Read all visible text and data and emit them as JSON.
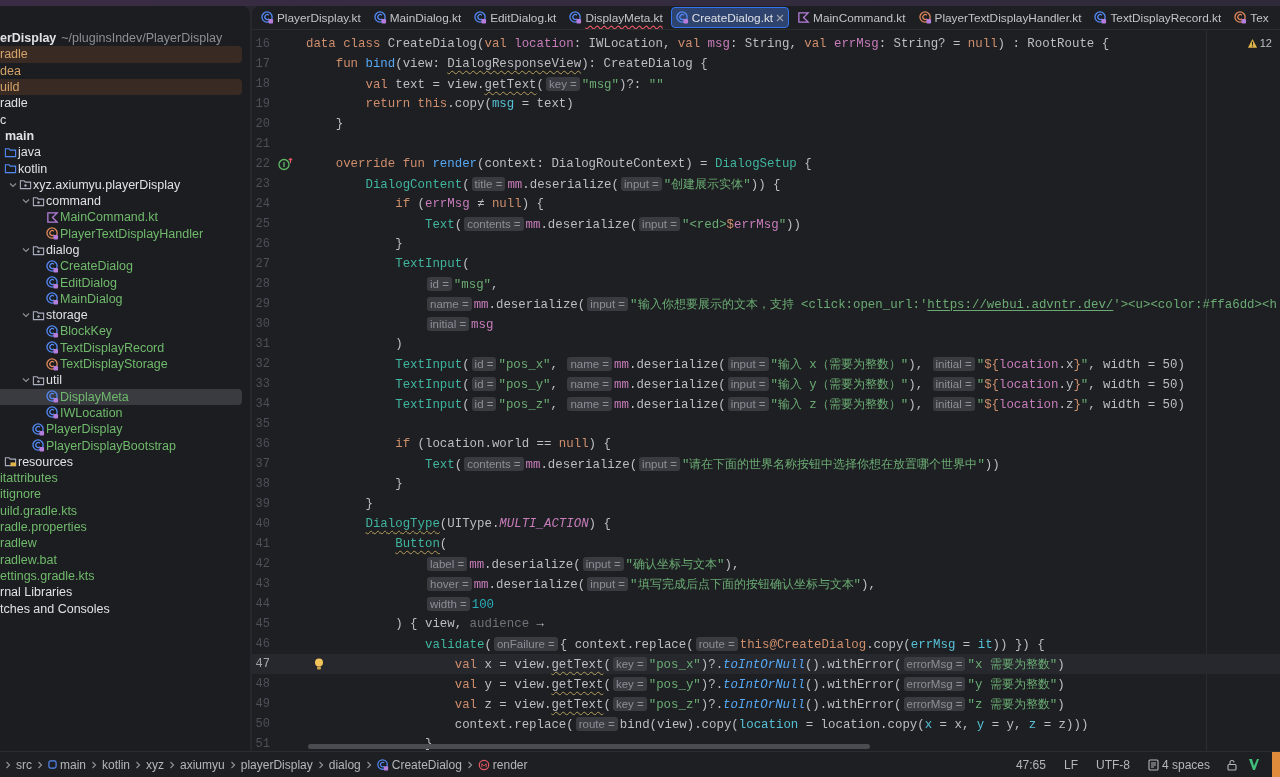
{
  "project": {
    "name": "erDisplay",
    "path": "~/pluginsIndev/PlayerDisplay",
    "items": [
      {
        "label": "radle",
        "ignored": true,
        "added": false,
        "excluded": true,
        "selected": false
      },
      {
        "label": "dea",
        "ignored": true,
        "added": false,
        "excluded": false,
        "selected": false
      },
      {
        "label": "uild",
        "ignored": true,
        "added": false,
        "excluded": true,
        "selected": false
      },
      {
        "label": "radle",
        "ignored": false,
        "added": false,
        "excluded": false,
        "selected": false
      },
      {
        "label": "c",
        "ignored": false,
        "added": false,
        "excluded": false,
        "selected": false,
        "children": [
          {
            "label": "main",
            "kind": "module",
            "selected": false,
            "children": [
              {
                "label": "java",
                "kind": "source-root",
                "selected": false
              },
              {
                "label": "kotlin",
                "kind": "source-root",
                "selected": false,
                "children": [
                  {
                    "label": "xyz.axiumyu.playerDisplay",
                    "kind": "package",
                    "expanded": true,
                    "selected": false,
                    "children": [
                      {
                        "label": "command",
                        "kind": "package",
                        "expanded": true,
                        "added": false,
                        "selected": false,
                        "children": [
                          {
                            "label": "MainCommand.kt",
                            "kind": "kotlin-file",
                            "added": true,
                            "selected": false
                          },
                          {
                            "label": "PlayerTextDisplayHandler",
                            "kind": "object",
                            "added": true,
                            "selected": false
                          }
                        ]
                      },
                      {
                        "label": "dialog",
                        "kind": "package",
                        "expanded": true,
                        "added": false,
                        "selected": false,
                        "children": [
                          {
                            "label": "CreateDialog",
                            "kind": "class",
                            "added": true,
                            "selected": false
                          },
                          {
                            "label": "EditDialog",
                            "kind": "class",
                            "added": true,
                            "selected": false
                          },
                          {
                            "label": "MainDialog",
                            "kind": "class",
                            "added": true,
                            "selected": false
                          }
                        ]
                      },
                      {
                        "label": "storage",
                        "kind": "package",
                        "expanded": true,
                        "added": false,
                        "selected": false,
                        "children": [
                          {
                            "label": "BlockKey",
                            "kind": "class",
                            "added": true,
                            "selected": false
                          },
                          {
                            "label": "TextDisplayRecord",
                            "kind": "class",
                            "added": true,
                            "selected": false
                          },
                          {
                            "label": "TextDisplayStorage",
                            "kind": "object",
                            "added": true,
                            "selected": false
                          }
                        ]
                      },
                      {
                        "label": "util",
                        "kind": "package",
                        "expanded": true,
                        "added": false,
                        "selected": false,
                        "children": [
                          {
                            "label": "DisplayMeta",
                            "kind": "class",
                            "added": true,
                            "selected": true
                          },
                          {
                            "label": "IWLocation",
                            "kind": "class",
                            "added": true,
                            "selected": false
                          }
                        ]
                      },
                      {
                        "label": "PlayerDisplay",
                        "kind": "class",
                        "added": true,
                        "selected": false
                      },
                      {
                        "label": "PlayerDisplayBootstrap",
                        "kind": "class",
                        "added": true,
                        "selected": false
                      }
                    ]
                  }
                ]
              },
              {
                "label": "resources",
                "kind": "resource-root",
                "selected": false
              }
            ]
          }
        ]
      },
      {
        "label": "itattributes",
        "ignored": false,
        "added": true,
        "excluded": false,
        "selected": false
      },
      {
        "label": "itignore",
        "ignored": false,
        "added": true,
        "excluded": false,
        "selected": false
      },
      {
        "label": "uild.gradle.kts",
        "ignored": false,
        "added": true,
        "excluded": false,
        "selected": false
      },
      {
        "label": "radle.properties",
        "ignored": false,
        "added": true,
        "excluded": false,
        "selected": false
      },
      {
        "label": "radlew",
        "ignored": false,
        "added": true,
        "excluded": false,
        "selected": false
      },
      {
        "label": "radlew.bat",
        "ignored": false,
        "added": true,
        "excluded": false,
        "selected": false
      },
      {
        "label": "ettings.gradle.kts",
        "ignored": false,
        "added": true,
        "excluded": false,
        "selected": false
      },
      {
        "label": "rnal Libraries",
        "ignored": false,
        "added": false,
        "excluded": false,
        "selected": false
      },
      {
        "label": "tches and Consoles",
        "ignored": false,
        "added": false,
        "excluded": false,
        "selected": false
      }
    ]
  },
  "tabs": [
    {
      "label": "PlayerDisplay.kt",
      "kind": "class",
      "selected": false,
      "error": false
    },
    {
      "label": "MainDialog.kt",
      "kind": "class",
      "selected": false,
      "error": false
    },
    {
      "label": "EditDialog.kt",
      "kind": "class",
      "selected": false,
      "error": false
    },
    {
      "label": "DisplayMeta.kt",
      "kind": "class",
      "selected": false,
      "error": true
    },
    {
      "label": "CreateDialog.kt",
      "kind": "class",
      "selected": true,
      "error": false
    },
    {
      "label": "MainCommand.kt",
      "kind": "kotlin-file",
      "selected": false,
      "error": false
    },
    {
      "label": "PlayerTextDisplayHandler.kt",
      "kind": "object",
      "selected": false,
      "error": false
    },
    {
      "label": "TextDisplayRecord.kt",
      "kind": "class",
      "selected": false,
      "error": false
    },
    {
      "label": "Tex",
      "kind": "object",
      "selected": false,
      "error": false
    }
  ],
  "editor": {
    "warnings": "12",
    "lines": [
      {
        "number": "16",
        "current": false,
        "tokens": [
          {
            "kind": "kw",
            "text": "data class "
          },
          {
            "kind": "plain",
            "text": "CreateDialog("
          },
          {
            "kind": "kw",
            "text": "val "
          },
          {
            "kind": "prop",
            "text": "location"
          },
          {
            "kind": "plain",
            "text": ": IWLocation, "
          },
          {
            "kind": "kw",
            "text": "val "
          },
          {
            "kind": "prop",
            "text": "msg"
          },
          {
            "kind": "plain",
            "text": ": String, "
          },
          {
            "kind": "kw",
            "text": "val "
          },
          {
            "kind": "prop",
            "text": "errMsg"
          },
          {
            "kind": "plain",
            "text": ": String? = "
          },
          {
            "kind": "kw",
            "text": "null"
          },
          {
            "kind": "plain",
            "text": ") : RootRoute {"
          }
        ]
      },
      {
        "number": "17",
        "current": false,
        "tokens": [
          {
            "kind": "kw",
            "text": "    fun "
          },
          {
            "kind": "fn",
            "text": "bind"
          },
          {
            "kind": "plain",
            "text": "(view: "
          },
          {
            "kind": "warn",
            "text": "DialogResponseView"
          },
          {
            "kind": "plain",
            "text": "): CreateDialog {"
          }
        ]
      },
      {
        "number": "18",
        "current": false,
        "tokens": [
          {
            "kind": "kw",
            "text": "        val "
          },
          {
            "kind": "plain",
            "text": "text = view."
          },
          {
            "kind": "warn",
            "text": "getText"
          },
          {
            "kind": "plain",
            "text": "("
          },
          {
            "kind": "hint",
            "text": "key ="
          },
          {
            "kind": "str",
            "text": "\"msg\""
          },
          {
            "kind": "plain",
            "text": ")?: "
          },
          {
            "kind": "str",
            "text": "\"\""
          }
        ]
      },
      {
        "number": "19",
        "current": false,
        "tokens": [
          {
            "kind": "kw",
            "text": "        return this"
          },
          {
            "kind": "plain",
            "text": ".copy("
          },
          {
            "kind": "arg",
            "text": "msg"
          },
          {
            "kind": "plain",
            "text": " = text)"
          }
        ]
      },
      {
        "number": "20",
        "current": false,
        "tokens": [
          {
            "kind": "plain",
            "text": "    }"
          }
        ]
      },
      {
        "number": "21",
        "current": false
      },
      {
        "number": "22",
        "current": false,
        "overrides": true,
        "tokens": [
          {
            "kind": "kw",
            "text": "    override fun "
          },
          {
            "kind": "fn",
            "text": "render"
          },
          {
            "kind": "plain",
            "text": "(context: DialogRouteContext) = "
          },
          {
            "kind": "call",
            "text": "DialogSetup"
          },
          {
            "kind": "plain",
            "text": " {"
          }
        ]
      },
      {
        "number": "23",
        "current": false,
        "tokens": [
          {
            "kind": "call",
            "text": "        DialogContent"
          },
          {
            "kind": "plain",
            "text": "("
          },
          {
            "kind": "hint",
            "text": "title ="
          },
          {
            "kind": "prop",
            "text": "mm"
          },
          {
            "kind": "plain",
            "text": ".deserialize("
          },
          {
            "kind": "hint",
            "text": "input ="
          },
          {
            "kind": "str",
            "text": "\"创建展示实体\""
          },
          {
            "kind": "plain",
            "text": ")) {"
          }
        ]
      },
      {
        "number": "24",
        "current": false,
        "tokens": [
          {
            "kind": "kw",
            "text": "            if "
          },
          {
            "kind": "plain",
            "text": "("
          },
          {
            "kind": "prop",
            "text": "errMsg"
          },
          {
            "kind": "plain",
            "text": " ≠ "
          },
          {
            "kind": "kw",
            "text": "null"
          },
          {
            "kind": "plain",
            "text": ") {"
          }
        ]
      },
      {
        "number": "25",
        "current": false,
        "tokens": [
          {
            "kind": "call",
            "text": "                Text"
          },
          {
            "kind": "plain",
            "text": "("
          },
          {
            "kind": "hint",
            "text": "contents ="
          },
          {
            "kind": "prop",
            "text": "mm"
          },
          {
            "kind": "plain",
            "text": ".deserialize("
          },
          {
            "kind": "hint",
            "text": "input ="
          },
          {
            "kind": "str",
            "text": "\"<red>"
          },
          {
            "kind": "kw",
            "text": "$"
          },
          {
            "kind": "prop",
            "text": "errMsg"
          },
          {
            "kind": "str",
            "text": "\""
          },
          {
            "kind": "plain",
            "text": "))"
          }
        ]
      },
      {
        "number": "26",
        "current": false,
        "tokens": [
          {
            "kind": "plain",
            "text": "            }"
          }
        ]
      },
      {
        "number": "27",
        "current": false,
        "tokens": [
          {
            "kind": "call",
            "text": "            TextInput"
          },
          {
            "kind": "plain",
            "text": "("
          }
        ]
      },
      {
        "number": "28",
        "current": false,
        "tokens": [
          {
            "kind": "hint",
            "text": "                id ="
          },
          {
            "kind": "str",
            "text": "\"msg\""
          },
          {
            "kind": "plain",
            "text": ","
          }
        ]
      },
      {
        "number": "29",
        "current": false,
        "tokens": [
          {
            "kind": "hint",
            "text": "                name ="
          },
          {
            "kind": "prop",
            "text": "mm"
          },
          {
            "kind": "plain",
            "text": ".deserialize("
          },
          {
            "kind": "hint",
            "text": "input ="
          },
          {
            "kind": "str",
            "text": "\"输入你想要展示的文本，支持 <click:open_url:'"
          },
          {
            "kind": "link",
            "text": "https://webui.advntr.dev/"
          },
          {
            "kind": "str",
            "text": "'><u><color:#ffa6dd><h"
          }
        ]
      },
      {
        "number": "30",
        "current": false,
        "tokens": [
          {
            "kind": "hint",
            "text": "                initial ="
          },
          {
            "kind": "prop",
            "text": "msg"
          }
        ]
      },
      {
        "number": "31",
        "current": false,
        "tokens": [
          {
            "kind": "plain",
            "text": "            )"
          }
        ]
      },
      {
        "number": "32",
        "current": false,
        "tokens": [
          {
            "kind": "call",
            "text": "            TextInput"
          },
          {
            "kind": "plain",
            "text": "("
          },
          {
            "kind": "hint",
            "text": "id ="
          },
          {
            "kind": "str",
            "text": "\"pos_x\""
          },
          {
            "kind": "plain",
            "text": ", "
          },
          {
            "kind": "hint",
            "text": "name ="
          },
          {
            "kind": "prop",
            "text": "mm"
          },
          {
            "kind": "plain",
            "text": ".deserialize("
          },
          {
            "kind": "hint",
            "text": "input ="
          },
          {
            "kind": "str",
            "text": "\"输入 x（需要为整数）\""
          },
          {
            "kind": "plain",
            "text": "), "
          },
          {
            "kind": "hint",
            "text": "initial ="
          },
          {
            "kind": "str",
            "text": "\""
          },
          {
            "kind": "kw",
            "text": "${"
          },
          {
            "kind": "prop",
            "text": "location"
          },
          {
            "kind": "plain",
            "text": ".x"
          },
          {
            "kind": "kw",
            "text": "}"
          },
          {
            "kind": "str",
            "text": "\""
          },
          {
            "kind": "plain",
            "text": ", width = 50)"
          }
        ]
      },
      {
        "number": "33",
        "current": false,
        "tokens": [
          {
            "kind": "call",
            "text": "            TextInput"
          },
          {
            "kind": "plain",
            "text": "("
          },
          {
            "kind": "hint",
            "text": "id ="
          },
          {
            "kind": "str",
            "text": "\"pos_y\""
          },
          {
            "kind": "plain",
            "text": ", "
          },
          {
            "kind": "hint",
            "text": "name ="
          },
          {
            "kind": "prop",
            "text": "mm"
          },
          {
            "kind": "plain",
            "text": ".deserialize("
          },
          {
            "kind": "hint",
            "text": "input ="
          },
          {
            "kind": "str",
            "text": "\"输入 y（需要为整数）\""
          },
          {
            "kind": "plain",
            "text": "), "
          },
          {
            "kind": "hint",
            "text": "initial ="
          },
          {
            "kind": "str",
            "text": "\""
          },
          {
            "kind": "kw",
            "text": "${"
          },
          {
            "kind": "prop",
            "text": "location"
          },
          {
            "kind": "plain",
            "text": ".y"
          },
          {
            "kind": "kw",
            "text": "}"
          },
          {
            "kind": "str",
            "text": "\""
          },
          {
            "kind": "plain",
            "text": ", width = 50)"
          }
        ]
      },
      {
        "number": "34",
        "current": false,
        "tokens": [
          {
            "kind": "call",
            "text": "            TextInput"
          },
          {
            "kind": "plain",
            "text": "("
          },
          {
            "kind": "hint",
            "text": "id ="
          },
          {
            "kind": "str",
            "text": "\"pos_z\""
          },
          {
            "kind": "plain",
            "text": ", "
          },
          {
            "kind": "hint",
            "text": "name ="
          },
          {
            "kind": "prop",
            "text": "mm"
          },
          {
            "kind": "plain",
            "text": ".deserialize("
          },
          {
            "kind": "hint",
            "text": "input ="
          },
          {
            "kind": "str",
            "text": "\"输入 z（需要为整数）\""
          },
          {
            "kind": "plain",
            "text": "), "
          },
          {
            "kind": "hint",
            "text": "initial ="
          },
          {
            "kind": "str",
            "text": "\""
          },
          {
            "kind": "kw",
            "text": "${"
          },
          {
            "kind": "prop",
            "text": "location"
          },
          {
            "kind": "plain",
            "text": ".z"
          },
          {
            "kind": "kw",
            "text": "}"
          },
          {
            "kind": "str",
            "text": "\""
          },
          {
            "kind": "plain",
            "text": ", width = 50)"
          }
        ]
      },
      {
        "number": "35",
        "current": false
      },
      {
        "number": "36",
        "current": false,
        "tokens": [
          {
            "kind": "kw",
            "text": "            if "
          },
          {
            "kind": "plain",
            "text": "(location.world == "
          },
          {
            "kind": "kw",
            "text": "null"
          },
          {
            "kind": "plain",
            "text": ") {"
          }
        ]
      },
      {
        "number": "37",
        "current": false,
        "tokens": [
          {
            "kind": "call",
            "text": "                Text"
          },
          {
            "kind": "plain",
            "text": "("
          },
          {
            "kind": "hint",
            "text": "contents ="
          },
          {
            "kind": "prop",
            "text": "mm"
          },
          {
            "kind": "plain",
            "text": ".deserialize("
          },
          {
            "kind": "hint",
            "text": "input ="
          },
          {
            "kind": "str",
            "text": "\"请在下面的世界名称按钮中选择你想在放置哪个世界中\""
          },
          {
            "kind": "plain",
            "text": "))"
          }
        ]
      },
      {
        "number": "38",
        "current": false,
        "tokens": [
          {
            "kind": "plain",
            "text": "            }"
          }
        ]
      },
      {
        "number": "39",
        "current": false,
        "tokens": [
          {
            "kind": "plain",
            "text": "        }"
          }
        ]
      },
      {
        "number": "40",
        "current": false,
        "tokens": [
          {
            "kind": "callwarn",
            "text": "        DialogType"
          },
          {
            "kind": "plain",
            "text": "(UIType."
          },
          {
            "kind": "const",
            "text": "MULTI_ACTION"
          },
          {
            "kind": "plain",
            "text": ") {"
          }
        ]
      },
      {
        "number": "41",
        "current": false,
        "tokens": [
          {
            "kind": "callwarn",
            "text": "            Button"
          },
          {
            "kind": "plain",
            "text": "("
          }
        ]
      },
      {
        "number": "42",
        "current": false,
        "tokens": [
          {
            "kind": "hint",
            "text": "                label ="
          },
          {
            "kind": "prop",
            "text": "mm"
          },
          {
            "kind": "plain",
            "text": ".deserialize("
          },
          {
            "kind": "hint",
            "text": "input ="
          },
          {
            "kind": "str",
            "text": "\"确认坐标与文本\""
          },
          {
            "kind": "plain",
            "text": "),"
          }
        ]
      },
      {
        "number": "43",
        "current": false,
        "tokens": [
          {
            "kind": "hint",
            "text": "                hover ="
          },
          {
            "kind": "prop",
            "text": "mm"
          },
          {
            "kind": "plain",
            "text": ".deserialize("
          },
          {
            "kind": "hint",
            "text": "input ="
          },
          {
            "kind": "str",
            "text": "\"填写完成后点下面的按钮确认坐标与文本\""
          },
          {
            "kind": "plain",
            "text": "),"
          }
        ]
      },
      {
        "number": "44",
        "current": false,
        "tokens": [
          {
            "kind": "hint",
            "text": "                width ="
          },
          {
            "kind": "num",
            "text": "100"
          }
        ]
      },
      {
        "number": "45",
        "current": false,
        "tokens": [
          {
            "kind": "plain",
            "text": "            ) { view, "
          },
          {
            "kind": "unused",
            "text": "audience"
          },
          {
            "kind": "plain",
            "text": " →"
          }
        ]
      },
      {
        "number": "46",
        "current": false,
        "tokens": [
          {
            "kind": "call",
            "text": "                validate"
          },
          {
            "kind": "plain",
            "text": "("
          },
          {
            "kind": "hint",
            "text": "onFailure ="
          },
          {
            "kind": "plain",
            "text": "{ context.replace("
          },
          {
            "kind": "hint",
            "text": "route ="
          },
          {
            "kind": "kw",
            "text": "this@CreateDialog"
          },
          {
            "kind": "plain",
            "text": ".copy("
          },
          {
            "kind": "arg",
            "text": "errMsg"
          },
          {
            "kind": "plain",
            "text": " = "
          },
          {
            "kind": "arg",
            "text": "it"
          },
          {
            "kind": "plain",
            "text": ")) }) {"
          }
        ]
      },
      {
        "number": "47",
        "current": true,
        "bulb": true,
        "tokens": [
          {
            "kind": "kw",
            "text": "                    val "
          },
          {
            "kind": "plain",
            "text": "x = view."
          },
          {
            "kind": "warn",
            "text": "getText"
          },
          {
            "kind": "plain",
            "text": "("
          },
          {
            "kind": "hint",
            "text": "key ="
          },
          {
            "kind": "str",
            "text": "\"pos_x\""
          },
          {
            "kind": "plain",
            "text": ")?."
          },
          {
            "kind": "ital",
            "text": "toIntOrNull"
          },
          {
            "kind": "plain",
            "text": "().withError("
          },
          {
            "kind": "hint",
            "text": "errorMsg ="
          },
          {
            "kind": "str",
            "text": "\"x 需要为整数\""
          },
          {
            "kind": "plain",
            "text": ")"
          }
        ]
      },
      {
        "number": "48",
        "current": false,
        "tokens": [
          {
            "kind": "kw",
            "text": "                    val "
          },
          {
            "kind": "plain",
            "text": "y = view."
          },
          {
            "kind": "warn",
            "text": "getText"
          },
          {
            "kind": "plain",
            "text": "("
          },
          {
            "kind": "hint",
            "text": "key ="
          },
          {
            "kind": "str",
            "text": "\"pos_y\""
          },
          {
            "kind": "plain",
            "text": ")?."
          },
          {
            "kind": "ital",
            "text": "toIntOrNull"
          },
          {
            "kind": "plain",
            "text": "().withError("
          },
          {
            "kind": "hint",
            "text": "errorMsg ="
          },
          {
            "kind": "str",
            "text": "\"y 需要为整数\""
          },
          {
            "kind": "plain",
            "text": ")"
          }
        ]
      },
      {
        "number": "49",
        "current": false,
        "tokens": [
          {
            "kind": "kw",
            "text": "                    val "
          },
          {
            "kind": "plain",
            "text": "z = view."
          },
          {
            "kind": "warn",
            "text": "getText"
          },
          {
            "kind": "plain",
            "text": "("
          },
          {
            "kind": "hint",
            "text": "key ="
          },
          {
            "kind": "str",
            "text": "\"pos_z\""
          },
          {
            "kind": "plain",
            "text": ")?."
          },
          {
            "kind": "ital",
            "text": "toIntOrNull"
          },
          {
            "kind": "plain",
            "text": "().withError("
          },
          {
            "kind": "hint",
            "text": "errorMsg ="
          },
          {
            "kind": "str",
            "text": "\"z 需要为整数\""
          },
          {
            "kind": "plain",
            "text": ")"
          }
        ]
      },
      {
        "number": "50",
        "current": false,
        "tokens": [
          {
            "kind": "plain",
            "text": "                    context.replace("
          },
          {
            "kind": "hint",
            "text": "route ="
          },
          {
            "kind": "plain",
            "text": "bind(view).copy("
          },
          {
            "kind": "arg",
            "text": "location"
          },
          {
            "kind": "plain",
            "text": " = location.copy("
          },
          {
            "kind": "arg",
            "text": "x"
          },
          {
            "kind": "plain",
            "text": " = x, "
          },
          {
            "kind": "arg",
            "text": "y"
          },
          {
            "kind": "plain",
            "text": " = y, "
          },
          {
            "kind": "arg",
            "text": "z"
          },
          {
            "kind": "plain",
            "text": " = z)))"
          }
        ]
      },
      {
        "number": "51",
        "current": false,
        "tokens": [
          {
            "kind": "plain",
            "text": "                }"
          }
        ]
      }
    ]
  },
  "breadcrumbs": [
    {
      "label": "src"
    },
    {
      "label": "main",
      "kind": "module"
    },
    {
      "label": "kotlin"
    },
    {
      "label": "xyz"
    },
    {
      "label": "axiumyu"
    },
    {
      "label": "playerDisplay"
    },
    {
      "label": "dialog"
    },
    {
      "label": "CreateDialog",
      "kind": "class"
    },
    {
      "label": "render",
      "kind": "method"
    }
  ],
  "status": {
    "caret": "47:65",
    "line_separator": "LF",
    "encoding": "UTF-8",
    "indent": "4 spaces"
  }
}
